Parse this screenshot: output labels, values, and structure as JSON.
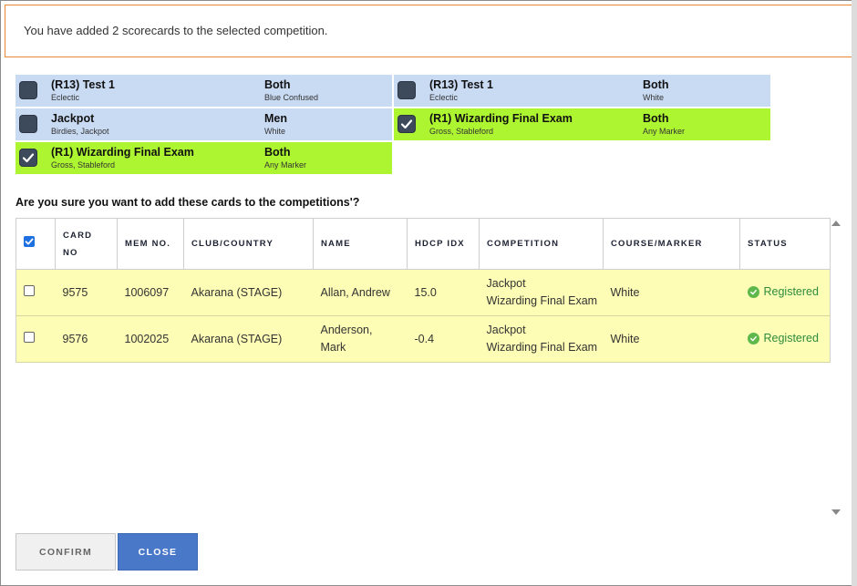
{
  "notice": {
    "text": "You have added 2 scorecards to the selected competition."
  },
  "tiles": [
    {
      "name": "(R13) Test 1",
      "sub": "Eclectic",
      "gender": "Both",
      "marker": "Blue Confused",
      "checked": false
    },
    {
      "name": "(R13) Test 1",
      "sub": "Eclectic",
      "gender": "Both",
      "marker": "White",
      "checked": false
    },
    {
      "name": "Jackpot",
      "sub": "Birdies, Jackpot",
      "gender": "Men",
      "marker": "White",
      "checked": false
    },
    {
      "name": "(R1) Wizarding Final Exam",
      "sub": "Gross, Stableford",
      "gender": "Both",
      "marker": "Any Marker",
      "checked": true
    },
    {
      "name": "(R1) Wizarding Final Exam",
      "sub": "Gross, Stableford",
      "gender": "Both",
      "marker": "Any Marker",
      "checked": true
    }
  ],
  "question": "Are you sure you want to add these cards to the competitions'?",
  "table": {
    "headers": {
      "card_no_1": "CARD",
      "card_no_2": "NO",
      "mem_no": "MEM NO.",
      "club": "CLUB/COUNTRY",
      "name": "NAME",
      "hdcp": "HDCP IDX",
      "competition": "COMPETITION",
      "course": "COURSE/MARKER",
      "status": "STATUS"
    },
    "rows": [
      {
        "card_no": "9575",
        "mem_no": "1006097",
        "club": "Akarana (STAGE)",
        "name_1": "Allan, Andrew",
        "name_2": "",
        "hdcp": "15.0",
        "comp_1": "Jackpot",
        "comp_2": "Wizarding Final Exam",
        "course": "White",
        "status": "Registered"
      },
      {
        "card_no": "9576",
        "mem_no": "1002025",
        "club": "Akarana (STAGE)",
        "name_1": "Anderson,",
        "name_2": "Mark",
        "hdcp": "-0.4",
        "comp_1": "Jackpot",
        "comp_2": "Wizarding Final Exam",
        "course": "White",
        "status": "Registered"
      }
    ]
  },
  "buttons": {
    "confirm": "CONFIRM",
    "close": "CLOSE"
  },
  "colors": {
    "tile_blue": "#c9daf3",
    "tile_green": "#adf531",
    "row_yellow": "#fdfdb5",
    "close_btn": "#4a78c8",
    "status_green": "#2e8b3d",
    "notice_border": "#e8893a"
  }
}
